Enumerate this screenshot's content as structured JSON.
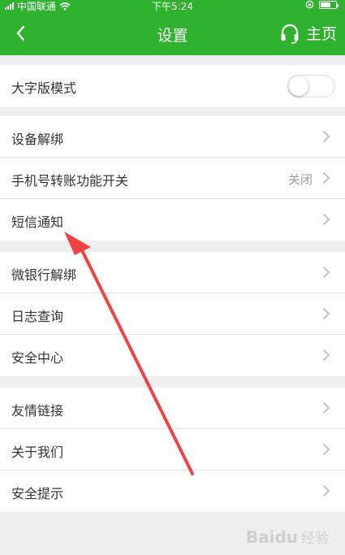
{
  "status_bar": {
    "carrier": "中国联通",
    "time": "下午5:24",
    "battery_level": 0.7
  },
  "nav": {
    "title": "设置",
    "home_label": "主页"
  },
  "toggle_row": {
    "label": "大字版模式",
    "enabled": false
  },
  "group1": [
    {
      "label": "设备解绑",
      "value": ""
    },
    {
      "label": "手机号转账功能开关",
      "value": "关闭"
    },
    {
      "label": "短信通知",
      "value": ""
    }
  ],
  "group2": [
    {
      "label": "微银行解绑"
    },
    {
      "label": "日志查询"
    },
    {
      "label": "安全中心"
    }
  ],
  "group3": [
    {
      "label": "友情链接"
    },
    {
      "label": "关于我们"
    },
    {
      "label": "安全提示"
    }
  ],
  "watermark": {
    "brand": "Baidu",
    "sub": "经验"
  },
  "colors": {
    "header_bg": "#2fb32f",
    "arrow": "#f04444"
  }
}
